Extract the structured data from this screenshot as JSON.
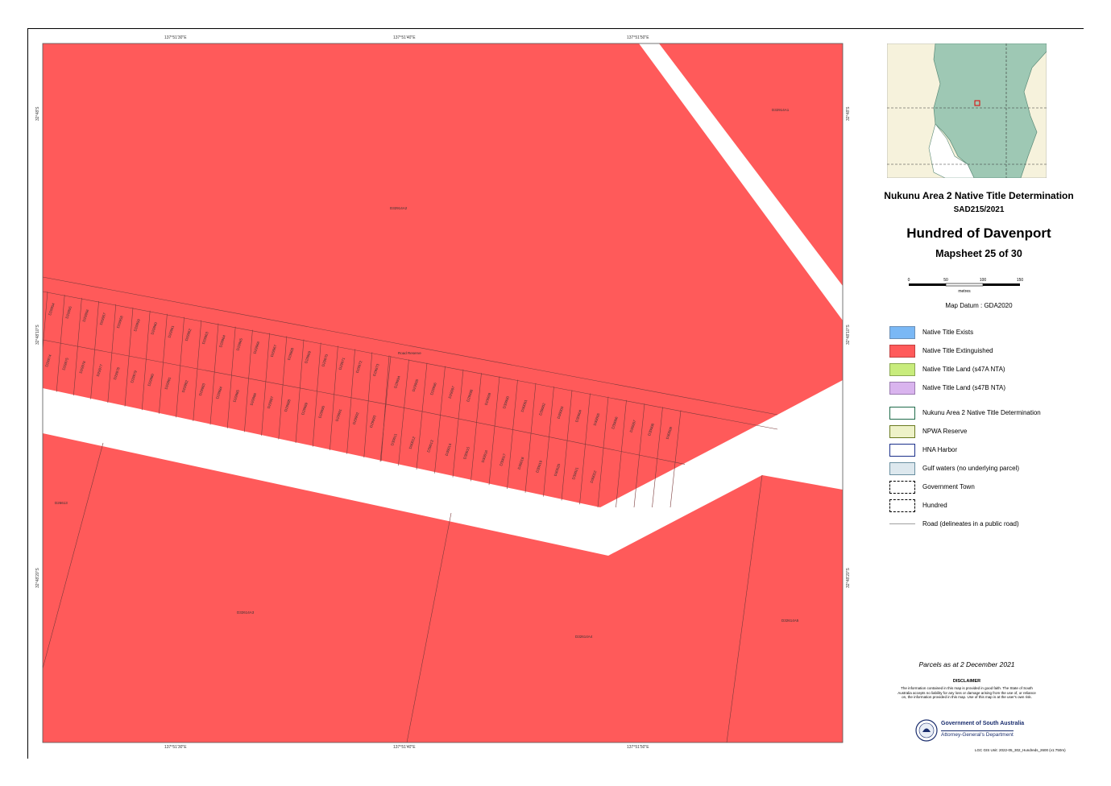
{
  "title": "Nukunu Area 2 Native Title Determination",
  "case_number": "SAD215/2021",
  "hundred": "Hundred of Davenport",
  "mapsheet": "Mapsheet 25 of 30",
  "scale": {
    "ticks": [
      "0",
      "50",
      "100",
      "150"
    ],
    "unit": "metres"
  },
  "datum": "Map Datum : GDA2020",
  "legend": [
    {
      "label": "Native Title Exists",
      "fill": "#7ab8f5",
      "border": "#6b8fb5"
    },
    {
      "label": "Native Title Extinguished",
      "fill": "#ff5a5a",
      "border": "#c04040"
    },
    {
      "label": "Native Title Land (s47A NTA)",
      "fill": "#c8ec7c",
      "border": "#8aa850"
    },
    {
      "label": "Native Title Land (s47B NTA)",
      "fill": "#d9b4ee",
      "border": "#9a7ab0"
    },
    {
      "label": "Nukunu Area 2 Native Title Determination",
      "fill": "#ffffff",
      "border": "#1f6b4a"
    },
    {
      "label": "NPWA Reserve",
      "fill": "#eef2c8",
      "border": "#6a7a20"
    },
    {
      "label": "HNA Harbor",
      "fill": "#ffffff",
      "border": "#1a2f8a"
    },
    {
      "label": "Gulf waters (no underlying parcel)",
      "fill": "#dde8ee",
      "border": "#6a8fa0"
    },
    {
      "label": "Government Town",
      "fill": "#ffffff",
      "border": "#000000"
    },
    {
      "label": "Hundred",
      "fill": "#ffffff",
      "border": "#000000"
    },
    {
      "label": "Road (delineates in a public road)",
      "fill": "none",
      "border": "#a0a0a0"
    }
  ],
  "parcels_date": "Parcels as at 2 December 2021",
  "disclaimer": {
    "title": "DISCLAIMER",
    "text": "The information contained in this map is provided in good faith. The State of South Australia accepts no liability for any loss or damage arising from the use of, or reliance on, the information provided in this map. Use of this map is at the user's own risk."
  },
  "government": {
    "name": "Government of South Australia",
    "department": "Attorney-General's Department"
  },
  "reference": "LGC GIS Unit: 2022-05_302_Hundreds_2600 (v1:750m)",
  "grid_labels": {
    "top": [
      "137°51'30\"E",
      "137°51'40\"E",
      "137°51'50\"E"
    ],
    "left": [
      "32°48'S",
      "32°48'10\"S",
      "32°48'20\"S"
    ]
  },
  "parcel_labels": {
    "large_north": "D32914A2",
    "northeast": "D32914A1",
    "road_label": "Road Reserve",
    "large_southwest": "D32614A3",
    "large_south_center": "D32614A4",
    "southeast": "D32614A5",
    "west_edge": "D26613",
    "row_upper": [
      "D29954",
      "D29955",
      "D29956",
      "D29957",
      "D29958",
      "D29959",
      "D29960",
      "D29961",
      "D29962",
      "D29963",
      "D29964",
      "D29965",
      "D29966",
      "D29967",
      "D29968",
      "D29969",
      "D29970",
      "D29971",
      "D29972",
      "D29973"
    ],
    "row_lower": [
      "D29974",
      "D29975",
      "D29976",
      "D29977",
      "D29978",
      "D29979",
      "D29980",
      "D29981",
      "D29982",
      "D29983",
      "D29984",
      "D29985",
      "D29986",
      "D29987",
      "D29988",
      "D29989",
      "D29990",
      "D29991",
      "D29992",
      "D29993"
    ],
    "row_east_upper": [
      "D29994",
      "D29995",
      "D29996",
      "D29997",
      "D29998",
      "D29999",
      "D30000",
      "D30001",
      "D30002",
      "D30003",
      "D30004",
      "D30005",
      "D30006",
      "D30007",
      "D30008",
      "D30009",
      "D30010"
    ],
    "row_east_lower": [
      "D30011",
      "D30012",
      "D30013",
      "D30014",
      "D30015",
      "D30016",
      "D30017",
      "D30018",
      "D30019",
      "D30020",
      "D30021",
      "D30022"
    ]
  }
}
